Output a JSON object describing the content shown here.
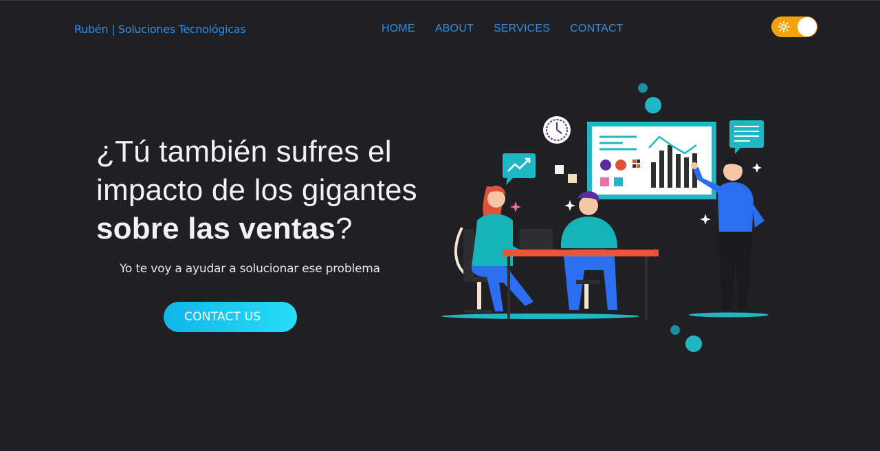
{
  "header": {
    "brand": "Rubén | Soluciones Tecnológicas",
    "nav": [
      "HOME",
      "ABOUT",
      "SERVICES",
      "CONTACT"
    ],
    "theme_toggle": {
      "state": "light",
      "accent": "#f5a20a"
    }
  },
  "hero": {
    "title_line1": "¿Tú también sufres el",
    "title_line2": "impacto de los gigantes",
    "title_bold": "sobre las ventas",
    "title_end": "?",
    "subtitle": "Yo te voy a ayudar a solucionar ese problema",
    "cta_label": "CONTACT US"
  },
  "colors": {
    "background": "#202024",
    "link": "#2f8fe8",
    "teal": "#1fb7c4",
    "cta_start": "#10b6e8",
    "cta_end": "#28dcf6"
  },
  "illustration": {
    "icon": "team-presentation-illustration"
  }
}
